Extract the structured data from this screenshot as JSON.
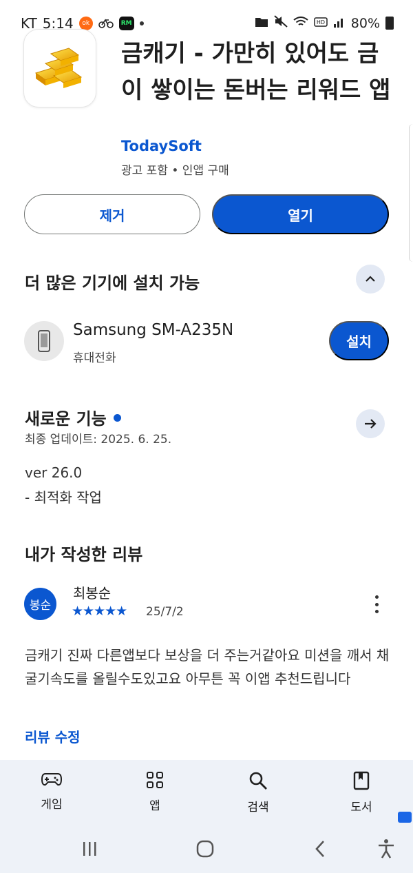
{
  "status_bar": {
    "carrier": "KT",
    "time": "5:14",
    "battery": "80%"
  },
  "app": {
    "title": "금캐기 - 가만히 있어도 금이 쌓이는 돈버는 리워드 앱",
    "developer": "TodaySoft",
    "meta": "광고 포함 • 인앱 구매",
    "uninstall_label": "제거",
    "open_label": "열기"
  },
  "devices_section": {
    "title": "더 많은 기기에 설치 가능",
    "device_name": "Samsung SM-A235N",
    "device_type": "휴대전화",
    "install_label": "설치"
  },
  "whats_new": {
    "title": "새로운 기능",
    "updated": "최종 업데이트: 2025. 6. 25.",
    "version": "ver 26.0",
    "changes": "- 최적화 작업"
  },
  "my_review": {
    "title": "내가 작성한 리뷰",
    "avatar_text": "봉순",
    "reviewer": "최봉순",
    "stars_text": "★★★★★",
    "rating": 5,
    "date": "25/7/2",
    "text": "금캐기 진짜 다른앱보다 보상을 더 주는거같아요 미션을 깨서 채굴기속도를 올릴수도있고요 아무튼 꼭 이앱 추천드립니다",
    "edit_label": "리뷰 수정"
  },
  "bottom_nav": {
    "items": [
      {
        "label": "게임",
        "icon": "gamepad-icon"
      },
      {
        "label": "앱",
        "icon": "apps-grid-icon"
      },
      {
        "label": "검색",
        "icon": "search-icon"
      },
      {
        "label": "도서",
        "icon": "book-icon"
      }
    ]
  },
  "colors": {
    "accent": "#0b57d0",
    "nav_bg": "#eef2f8"
  }
}
